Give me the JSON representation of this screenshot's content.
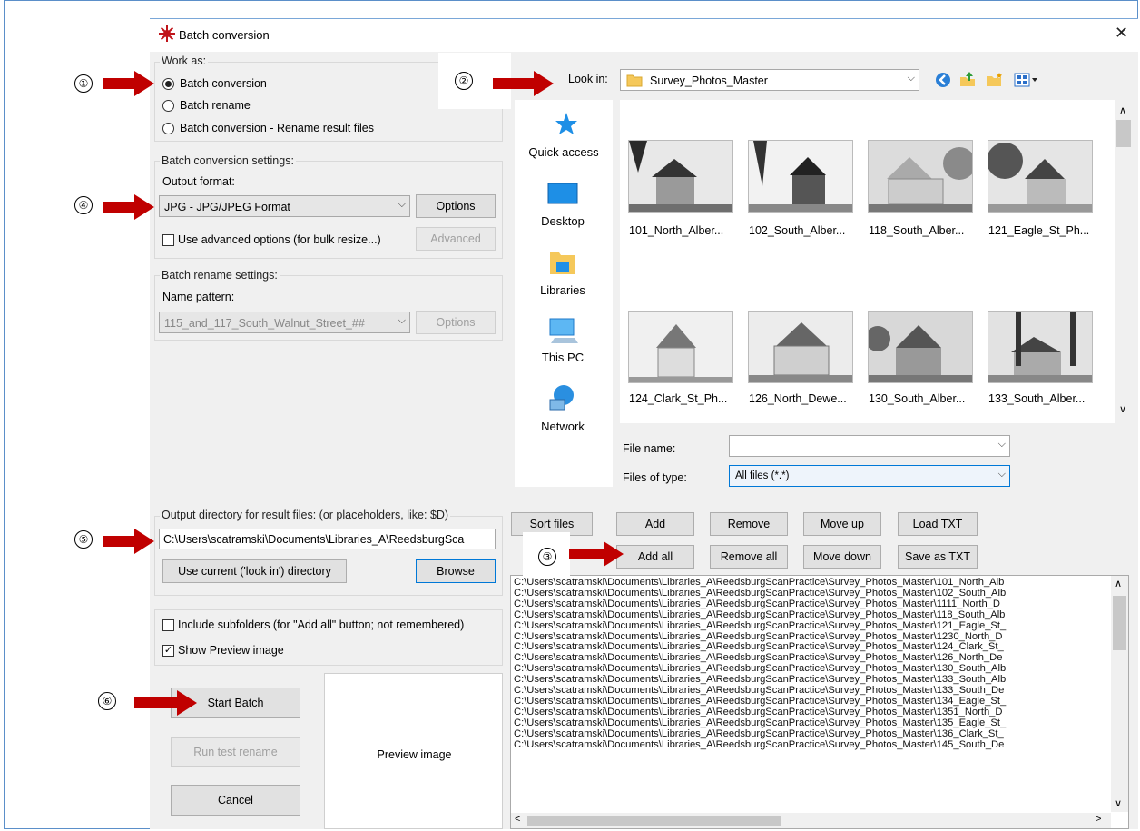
{
  "window": {
    "title": "Batch conversion",
    "close_glyph": "✕"
  },
  "callouts": [
    "①",
    "②",
    "③",
    "④",
    "⑤",
    "⑥"
  ],
  "work_as": {
    "label": "Work as:",
    "options": [
      "Batch conversion",
      "Batch rename",
      "Batch conversion - Rename result files"
    ],
    "selected_index": 0
  },
  "conversion": {
    "group_label": "Batch conversion settings:",
    "output_format_label": "Output format:",
    "output_format_value": "JPG - JPG/JPEG Format",
    "options_button": "Options",
    "advanced_checkbox_label": "Use advanced options (for bulk resize...)",
    "advanced_checked": false,
    "advanced_button": "Advanced"
  },
  "rename": {
    "group_label": "Batch rename settings:",
    "pattern_label": "Name pattern:",
    "pattern_value": "115_and_117_South_Walnut_Street_##",
    "options_button": "Options"
  },
  "output_dir": {
    "label": "Output directory for result files: (or placeholders, like: $D)",
    "value": "C:\\Users\\scatramski\\Documents\\Libraries_A\\ReedsburgSca",
    "use_current_button": "Use current ('look in') directory",
    "browse_button": "Browse"
  },
  "options": {
    "include_subfolders": "Include subfolders (for \"Add all\" button; not remembered)",
    "include_subfolders_checked": false,
    "show_preview": "Show Preview image",
    "show_preview_checked": true
  },
  "actions": {
    "start": "Start Batch",
    "test_rename": "Run test rename",
    "cancel": "Cancel"
  },
  "preview": {
    "label": "Preview image"
  },
  "browser": {
    "look_in_label": "Look in:",
    "look_in_value": "Survey_Photos_Master",
    "places": [
      "Quick access",
      "Desktop",
      "Libraries",
      "This PC",
      "Network"
    ],
    "files_row1": [
      "101_North_Alber...",
      "102_South_Alber...",
      "118_South_Alber...",
      "121_Eagle_St_Ph..."
    ],
    "files_row2": [
      "124_Clark_St_Ph...",
      "126_North_Dewe...",
      "130_South_Alber...",
      "133_South_Alber..."
    ],
    "file_name_label": "File name:",
    "file_name_value": "",
    "file_type_label": "Files of type:",
    "file_type_value": "All files (*.*)"
  },
  "list_buttons": {
    "sort": "Sort files",
    "add": "Add",
    "remove": "Remove",
    "move_up": "Move up",
    "load_txt": "Load TXT",
    "add_all": "Add all",
    "remove_all": "Remove all",
    "move_down": "Move down",
    "save_txt": "Save as TXT"
  },
  "file_list": [
    "C:\\Users\\scatramski\\Documents\\Libraries_A\\ReedsburgScanPractice\\Survey_Photos_Master\\101_North_Alb",
    "C:\\Users\\scatramski\\Documents\\Libraries_A\\ReedsburgScanPractice\\Survey_Photos_Master\\102_South_Alb",
    "C:\\Users\\scatramski\\Documents\\Libraries_A\\ReedsburgScanPractice\\Survey_Photos_Master\\1111_North_D",
    "C:\\Users\\scatramski\\Documents\\Libraries_A\\ReedsburgScanPractice\\Survey_Photos_Master\\118_South_Alb",
    "C:\\Users\\scatramski\\Documents\\Libraries_A\\ReedsburgScanPractice\\Survey_Photos_Master\\121_Eagle_St_",
    "C:\\Users\\scatramski\\Documents\\Libraries_A\\ReedsburgScanPractice\\Survey_Photos_Master\\1230_North_D",
    "C:\\Users\\scatramski\\Documents\\Libraries_A\\ReedsburgScanPractice\\Survey_Photos_Master\\124_Clark_St_",
    "C:\\Users\\scatramski\\Documents\\Libraries_A\\ReedsburgScanPractice\\Survey_Photos_Master\\126_North_De",
    "C:\\Users\\scatramski\\Documents\\Libraries_A\\ReedsburgScanPractice\\Survey_Photos_Master\\130_South_Alb",
    "C:\\Users\\scatramski\\Documents\\Libraries_A\\ReedsburgScanPractice\\Survey_Photos_Master\\133_South_Alb",
    "C:\\Users\\scatramski\\Documents\\Libraries_A\\ReedsburgScanPractice\\Survey_Photos_Master\\133_South_De",
    "C:\\Users\\scatramski\\Documents\\Libraries_A\\ReedsburgScanPractice\\Survey_Photos_Master\\134_Eagle_St_",
    "C:\\Users\\scatramski\\Documents\\Libraries_A\\ReedsburgScanPractice\\Survey_Photos_Master\\1351_North_D",
    "C:\\Users\\scatramski\\Documents\\Libraries_A\\ReedsburgScanPractice\\Survey_Photos_Master\\135_Eagle_St_",
    "C:\\Users\\scatramski\\Documents\\Libraries_A\\ReedsburgScanPractice\\Survey_Photos_Master\\136_Clark_St_",
    "C:\\Users\\scatramski\\Documents\\Libraries_A\\ReedsburgScanPractice\\Survey_Photos_Master\\145_South_De"
  ],
  "colors": {
    "callout_arrow": "#c00000",
    "accent": "#0078d7",
    "dialog_bg": "#f0f0f0"
  },
  "icons": {
    "app": "app-red-star-icon",
    "quick_access": "star-icon",
    "desktop": "desktop-icon",
    "libraries": "libraries-icon",
    "this_pc": "computer-icon",
    "network": "network-icon",
    "nav": [
      "back-icon",
      "up-folder-icon",
      "new-folder-icon",
      "view-menu-icon"
    ]
  }
}
